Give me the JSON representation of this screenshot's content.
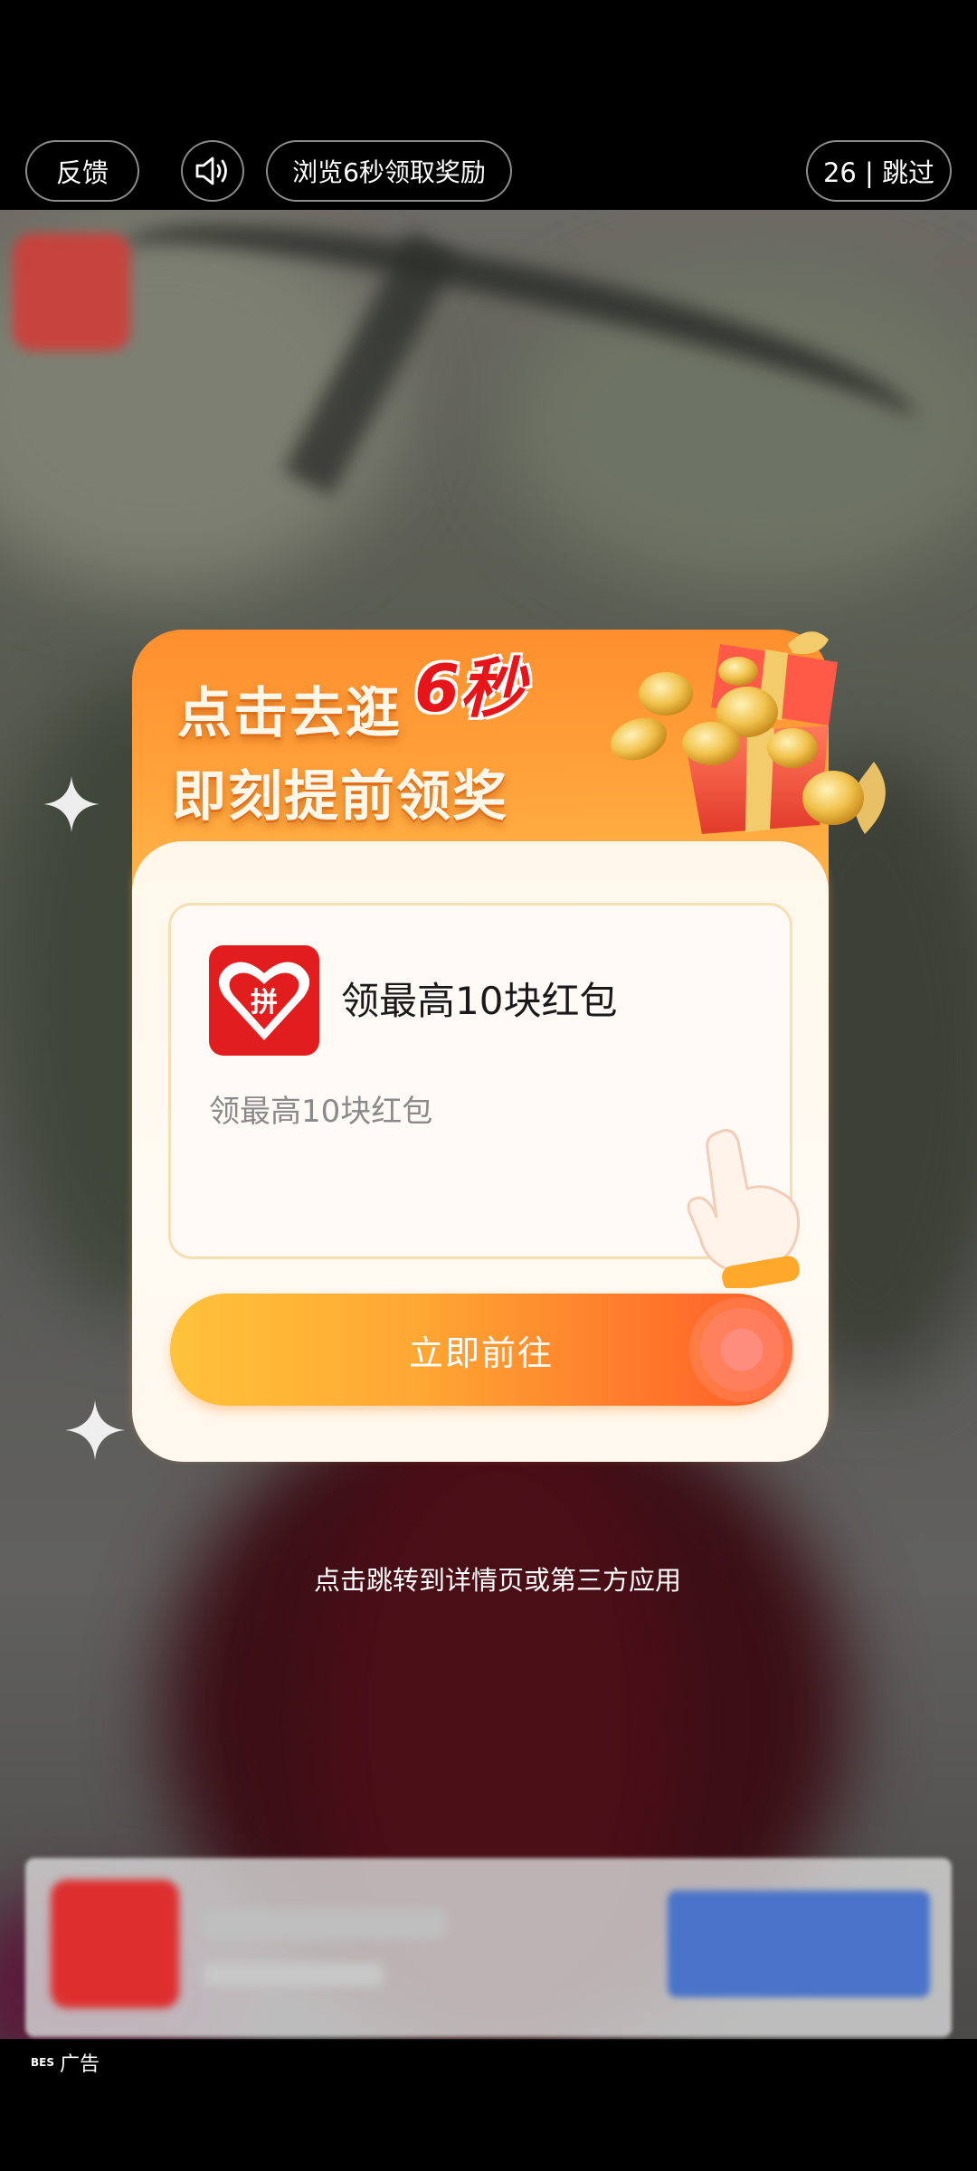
{
  "top_bar": {
    "feedback_label": "反馈",
    "sound_icon": "speaker-icon",
    "browse_label": "浏览6秒领取奖励",
    "skip_label": "26 | 跳过"
  },
  "modal": {
    "headline_line1": "点击去逛",
    "headline_seconds": "6秒",
    "headline_line2": "即刻提前领奖",
    "app_title": "领最高10块红包",
    "app_desc": "领最高10块红包",
    "cta_label": "立即前往",
    "app_logo_glyph": "拼"
  },
  "hint_text": "点击跳转到详情页或第三方应用",
  "ad_label": {
    "bes": "BES",
    "text": "广告"
  },
  "colors": {
    "accent_orange": "#ff8f2e",
    "cta_red": "#ff5a26",
    "logo_red": "#e21d1d"
  }
}
